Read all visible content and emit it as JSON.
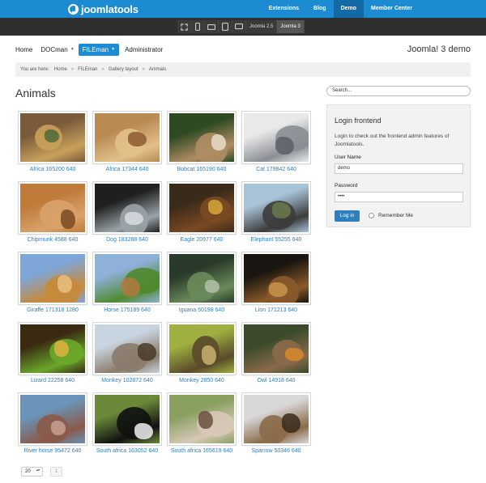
{
  "brand": {
    "name": "joomlatools"
  },
  "top_nav": [
    {
      "label": "Extensions",
      "active": false
    },
    {
      "label": "Blog",
      "active": false
    },
    {
      "label": "Demo",
      "active": true
    },
    {
      "label": "Member Center",
      "active": false
    }
  ],
  "device_bar": {
    "icons": [
      "fullscreen-icon",
      "phone-icon",
      "phone-landscape-icon",
      "tablet-icon",
      "desktop-icon"
    ],
    "versions": [
      "Joomla 2.5",
      "Joomla 3"
    ],
    "selected_version": "Joomla 3"
  },
  "main_nav": [
    {
      "label": "Home",
      "dropdown": false,
      "active": false
    },
    {
      "label": "DOCman",
      "dropdown": true,
      "active": false
    },
    {
      "label": "FILEman",
      "dropdown": true,
      "active": true
    },
    {
      "label": "Administrator",
      "dropdown": false,
      "active": false
    }
  ],
  "site_title": "Joomla! 3 demo",
  "breadcrumb": {
    "prefix": "You are here:",
    "items": [
      "Home",
      "FILEman",
      "Gallery layout",
      "Animals"
    ]
  },
  "page_title": "Animals",
  "gallery": [
    {
      "caption": "Africa 165200 640",
      "colors": [
        "#7a5a3a",
        "#c9a15b",
        "#4e6b3a"
      ]
    },
    {
      "caption": "Africa 17344 640",
      "colors": [
        "#b98a52",
        "#e2c08a",
        "#8a5a30"
      ]
    },
    {
      "caption": "Bobcat 165190 640",
      "colors": [
        "#2d4a22",
        "#b08d63",
        "#e8dccb"
      ]
    },
    {
      "caption": "Cat 179842 640",
      "colors": [
        "#e9e9e9",
        "#8a8f95",
        "#5a6068"
      ]
    },
    {
      "caption": "Chipmunk 4588 640",
      "colors": [
        "#c07a3a",
        "#d8a26a",
        "#7a4a22"
      ]
    },
    {
      "caption": "Dog 183288 640",
      "colors": [
        "#1f1f1f",
        "#9aa3a8",
        "#d7dde0"
      ]
    },
    {
      "caption": "Eagle 20977 640",
      "colors": [
        "#3a2a1a",
        "#7a4a22",
        "#d6a73a"
      ]
    },
    {
      "caption": "Elephant 55255 640",
      "colors": [
        "#a8c4d8",
        "#3c3c3c",
        "#6a7a4a"
      ]
    },
    {
      "caption": "Giraffe 171318 1280",
      "colors": [
        "#7fa6d8",
        "#c68a3a",
        "#e5c080"
      ]
    },
    {
      "caption": "Horse 175189 640",
      "colors": [
        "#8fb0d8",
        "#4f8a2f",
        "#b07840"
      ]
    },
    {
      "caption": "Iguana 50198 640",
      "colors": [
        "#2a3a2a",
        "#6a8a5a",
        "#b3c0a8"
      ]
    },
    {
      "caption": "Lion 171213 640",
      "colors": [
        "#1a1510",
        "#8a5a2a",
        "#c8944a"
      ]
    },
    {
      "caption": "Lizard 22258 640",
      "colors": [
        "#3a2a12",
        "#6aa82a",
        "#e0b040"
      ]
    },
    {
      "caption": "Monkey 102872 640",
      "colors": [
        "#c8d4e0",
        "#8a7a6a",
        "#4a3a2a"
      ]
    },
    {
      "caption": "Monkey 2850 640",
      "colors": [
        "#a0b040",
        "#5a4a2a",
        "#c8b070"
      ]
    },
    {
      "caption": "Owl 14918 640",
      "colors": [
        "#3a4a2a",
        "#8a6a4a",
        "#d88a2a"
      ]
    },
    {
      "caption": "River horse 95472 640",
      "colors": [
        "#6a94b8",
        "#8a5a4a",
        "#c8a090"
      ]
    },
    {
      "caption": "South africa 163052 640",
      "colors": [
        "#6a8a3a",
        "#111111",
        "#f0f0f0"
      ]
    },
    {
      "caption": "South africa 165619 640",
      "colors": [
        "#8aa060",
        "#d8c8b8",
        "#6a5040"
      ]
    },
    {
      "caption": "Sparrow 50346 640",
      "colors": [
        "#d8d8d8",
        "#8a6a4a",
        "#3a2a1a"
      ]
    }
  ],
  "pagination": {
    "limit": "20",
    "page": "1"
  },
  "search": {
    "placeholder": "Search..."
  },
  "login": {
    "title": "Login frontend",
    "intro": "Login to check out the frontend admin features of Joomlatools.",
    "username_label": "User Name",
    "username_value": "demo",
    "password_label": "Password",
    "password_value": "••••",
    "submit_label": "Log in",
    "remember_label": "Remember Me"
  },
  "colors": {
    "accent": "#1d8bd1",
    "link": "#2f7fc1",
    "dark_bar": "#2f2f2f"
  }
}
